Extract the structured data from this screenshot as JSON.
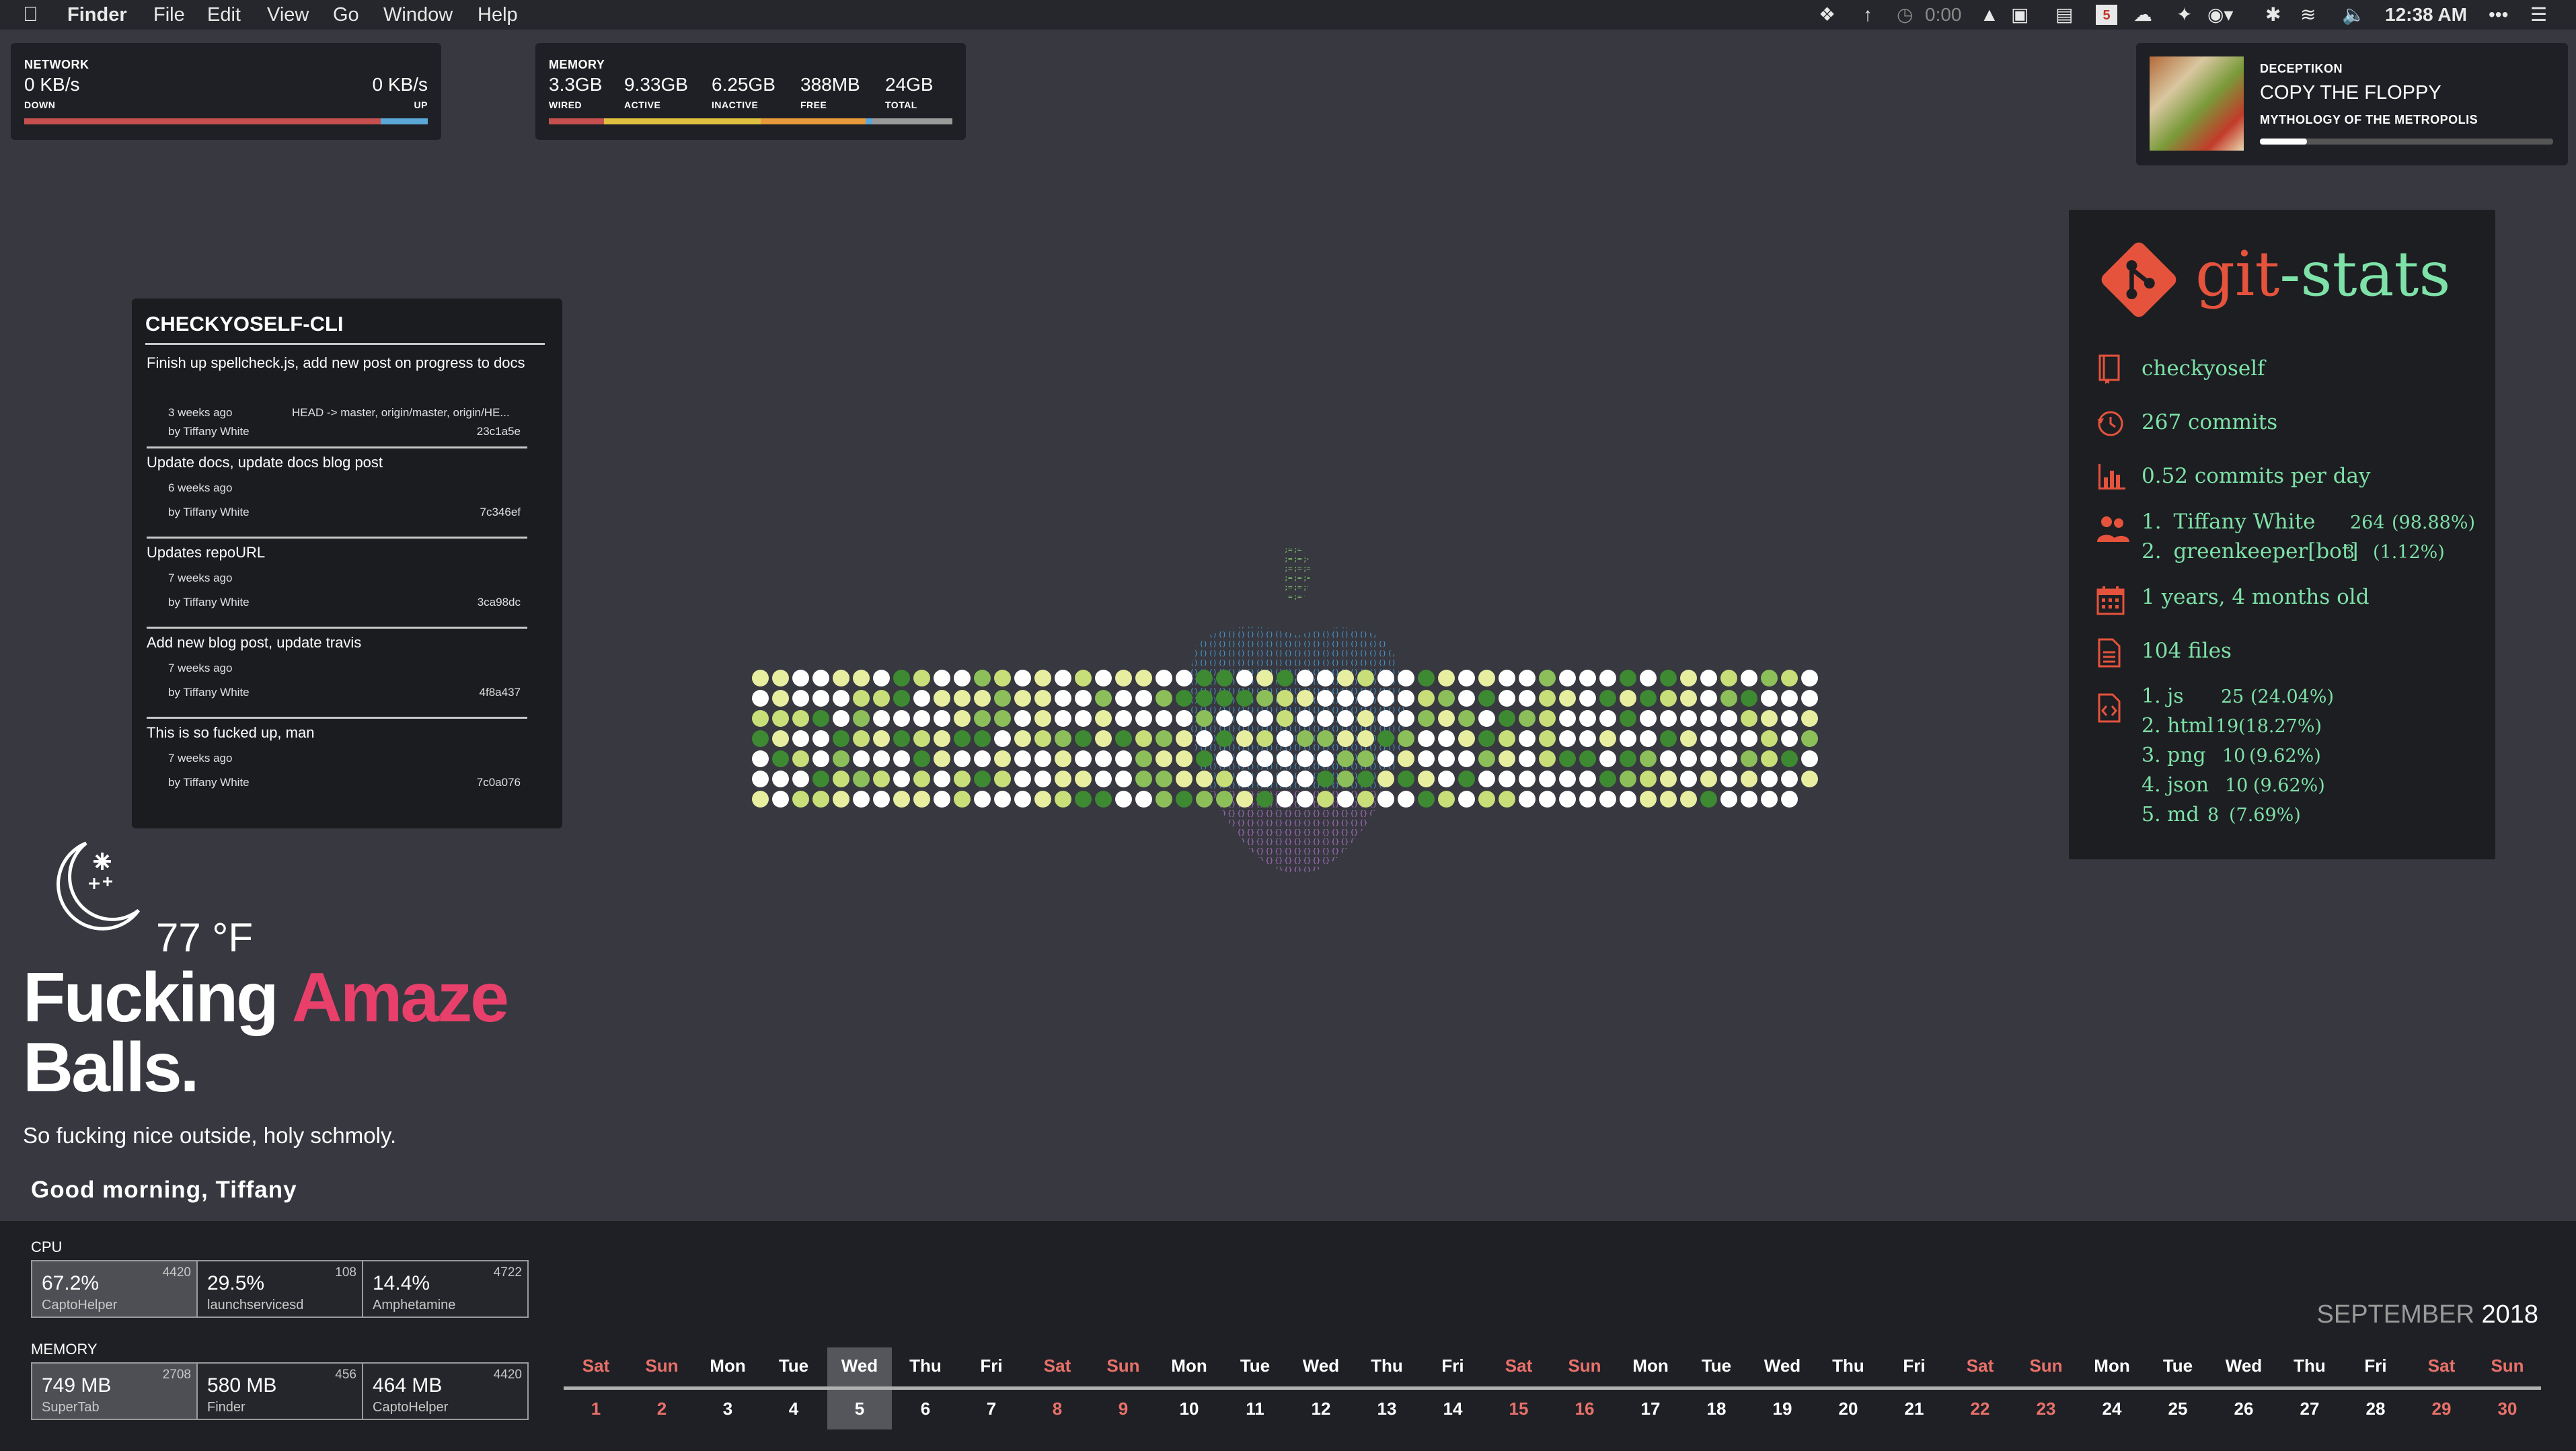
{
  "menubar": {
    "apple_icon": "apple-logo",
    "app_name": "Finder",
    "menus": [
      "File",
      "Edit",
      "View",
      "Go",
      "Window",
      "Help"
    ],
    "timer": "0:00",
    "calendar_badge": "5",
    "clock": "12:38 AM"
  },
  "network": {
    "title": "NETWORK",
    "down_value": "0 KB/s",
    "down_label": "DOWN",
    "up_value": "0 KB/s",
    "up_label": "UP",
    "colors": {
      "down": "#c6504f",
      "up": "#5aa7d8"
    }
  },
  "memory": {
    "title": "MEMORY",
    "items": [
      {
        "value": "3.3GB",
        "label": "WIRED"
      },
      {
        "value": "9.33GB",
        "label": "ACTIVE"
      },
      {
        "value": "6.25GB",
        "label": "INACTIVE"
      },
      {
        "value": "388MB",
        "label": "FREE"
      },
      {
        "value": "24GB",
        "label": "TOTAL"
      }
    ],
    "colors": [
      "#c6504f",
      "#e0c040",
      "#e89a3a",
      "#5aa7d8",
      "#9a9a9a"
    ]
  },
  "now_playing": {
    "artist": "DECEPTIKON",
    "track": "COPY THE FLOPPY",
    "album": "MYTHOLOGY OF THE METROPOLIS",
    "progress": 0.16
  },
  "git_log": {
    "title": "CHECKYOSELF-CLI",
    "commits": [
      {
        "message": "Finish up spellcheck.js, add new post on progress to docs",
        "age": "3 weeks ago",
        "refs": "HEAD -> master, origin/master, origin/HE...",
        "author": "by Tiffany White",
        "hash": "23c1a5e"
      },
      {
        "message": "Update docs, update docs blog post",
        "age": "6 weeks ago",
        "refs": "",
        "author": "by Tiffany White",
        "hash": "7c346ef"
      },
      {
        "message": "Updates repoURL",
        "age": "7 weeks ago",
        "refs": "",
        "author": "by Tiffany White",
        "hash": "3ca98dc"
      },
      {
        "message": "Add new blog post, update travis",
        "age": "7 weeks ago",
        "refs": "",
        "author": "by Tiffany White",
        "hash": "4f8a437"
      },
      {
        "message": "This is so fucked up, man",
        "age": "7 weeks ago",
        "refs": "",
        "author": "by Tiffany White",
        "hash": "7c0a076"
      }
    ]
  },
  "git_stats": {
    "title_git": "git",
    "title_stats": "-stats",
    "repo": "checkyoself",
    "commits": "267 commits",
    "per_day": "0.52 commits per day",
    "authors": [
      {
        "rank": "1.",
        "name": "Tiffany White",
        "count": "264",
        "pct": "(98.88%)"
      },
      {
        "rank": "2.",
        "name": "greenkeeper[bot]",
        "count": "3",
        "pct": "(1.12%)"
      }
    ],
    "age": "1 years, 4 months old",
    "files": "104 files",
    "filetypes": [
      {
        "rank": "1.",
        "ext": "js",
        "count": "25",
        "pct": "(24.04%)"
      },
      {
        "rank": "2.",
        "ext": "html",
        "count": "19",
        "pct": "(18.27%)"
      },
      {
        "rank": "3.",
        "ext": "png",
        "count": "10",
        "pct": "(9.62%)"
      },
      {
        "rank": "4.",
        "ext": "json",
        "count": "10",
        "pct": "(9.62%)"
      },
      {
        "rank": "5.",
        "ext": "md",
        "count": "8",
        "pct": "(7.69%)"
      }
    ],
    "colors": {
      "accent": "#e5533c",
      "text": "#7ee2a8"
    }
  },
  "weather": {
    "icon": "moon-snow-icon",
    "temperature": "77 °F",
    "headline_1": "Fucking",
    "headline_accent": "Amaze",
    "headline_2": "Balls.",
    "description": "So fucking nice outside, holy schmoly.",
    "accent_color": "#e8406b"
  },
  "greeting": "Good morning, Tiffany",
  "cpu": {
    "title": "CPU",
    "processes": [
      {
        "value": "67.2%",
        "pid": "4420",
        "name": "CaptoHelper"
      },
      {
        "value": "29.5%",
        "pid": "108",
        "name": "launchservicesd"
      },
      {
        "value": "14.4%",
        "pid": "4722",
        "name": "Amphetamine"
      }
    ]
  },
  "mem_procs": {
    "title": "MEMORY",
    "processes": [
      {
        "value": "749 MB",
        "pid": "2708",
        "name": "SuperTab"
      },
      {
        "value": "580 MB",
        "pid": "456",
        "name": "Finder"
      },
      {
        "value": "464 MB",
        "pid": "4420",
        "name": "CaptoHelper"
      }
    ]
  },
  "calendar": {
    "month": "SEPTEMBER",
    "year": "2018",
    "today": 5,
    "days": [
      {
        "wd": "Sat",
        "d": "1"
      },
      {
        "wd": "Sun",
        "d": "2"
      },
      {
        "wd": "Mon",
        "d": "3"
      },
      {
        "wd": "Tue",
        "d": "4"
      },
      {
        "wd": "Wed",
        "d": "5"
      },
      {
        "wd": "Thu",
        "d": "6"
      },
      {
        "wd": "Fri",
        "d": "7"
      },
      {
        "wd": "Sat",
        "d": "8"
      },
      {
        "wd": "Sun",
        "d": "9"
      },
      {
        "wd": "Mon",
        "d": "10"
      },
      {
        "wd": "Tue",
        "d": "11"
      },
      {
        "wd": "Wed",
        "d": "12"
      },
      {
        "wd": "Thu",
        "d": "13"
      },
      {
        "wd": "Fri",
        "d": "14"
      },
      {
        "wd": "Sat",
        "d": "15"
      },
      {
        "wd": "Sun",
        "d": "16"
      },
      {
        "wd": "Mon",
        "d": "17"
      },
      {
        "wd": "Tue",
        "d": "18"
      },
      {
        "wd": "Wed",
        "d": "19"
      },
      {
        "wd": "Thu",
        "d": "20"
      },
      {
        "wd": "Fri",
        "d": "21"
      },
      {
        "wd": "Sat",
        "d": "22"
      },
      {
        "wd": "Sun",
        "d": "23"
      },
      {
        "wd": "Mon",
        "d": "24"
      },
      {
        "wd": "Tue",
        "d": "25"
      },
      {
        "wd": "Wed",
        "d": "26"
      },
      {
        "wd": "Thu",
        "d": "27"
      },
      {
        "wd": "Fri",
        "d": "28"
      },
      {
        "wd": "Sat",
        "d": "29"
      },
      {
        "wd": "Sun",
        "d": "30"
      }
    ],
    "weekend_color": "#e8716a"
  }
}
